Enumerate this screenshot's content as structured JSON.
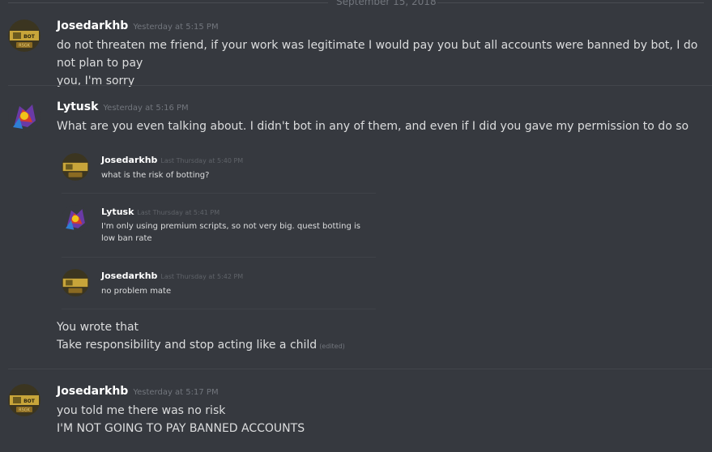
{
  "date_divider": "September 15, 2018",
  "messages": [
    {
      "user": "Josedarkhb",
      "timestamp": "Yesterday at 5:15 PM",
      "lines": [
        "do not threaten me friend, if your work was legitimate I would pay you but all accounts were banned by bot, I do not plan to pay",
        "you, I'm sorry"
      ]
    },
    {
      "user": "Lytusk",
      "timestamp": "Yesterday at 5:16 PM",
      "lines": [
        "What are you even talking about. I didn't bot in any of them, and even if I did you gave my permission to do so"
      ],
      "quoted": [
        {
          "user": "Josedarkhb",
          "timestamp": "Last Thursday at 5:40 PM",
          "lines": [
            "what is the risk of botting?"
          ]
        },
        {
          "user": "Lytusk",
          "timestamp": "Last Thursday at 5:41 PM",
          "lines": [
            "I'm only using premium scripts, so not very big. quest botting is",
            "low ban rate"
          ]
        },
        {
          "user": "Josedarkhb",
          "timestamp": "Last Thursday at 5:42 PM",
          "lines": [
            "no problem mate"
          ]
        }
      ],
      "after_lines": [
        "You wrote that",
        "Take responsibility and stop acting like a child"
      ],
      "edited_label": "(edited)"
    },
    {
      "user": "Josedarkhb",
      "timestamp": "Yesterday at 5:17 PM",
      "lines": [
        "you told me there was no risk",
        "I'M NOT GOING TO PAY BANNED ACCOUNTS"
      ]
    }
  ],
  "avatar_badge": "RSGK",
  "colors": {
    "background": "#36393f",
    "username": "#ffffff",
    "text": "#dcddde",
    "muted": "#72767d"
  }
}
